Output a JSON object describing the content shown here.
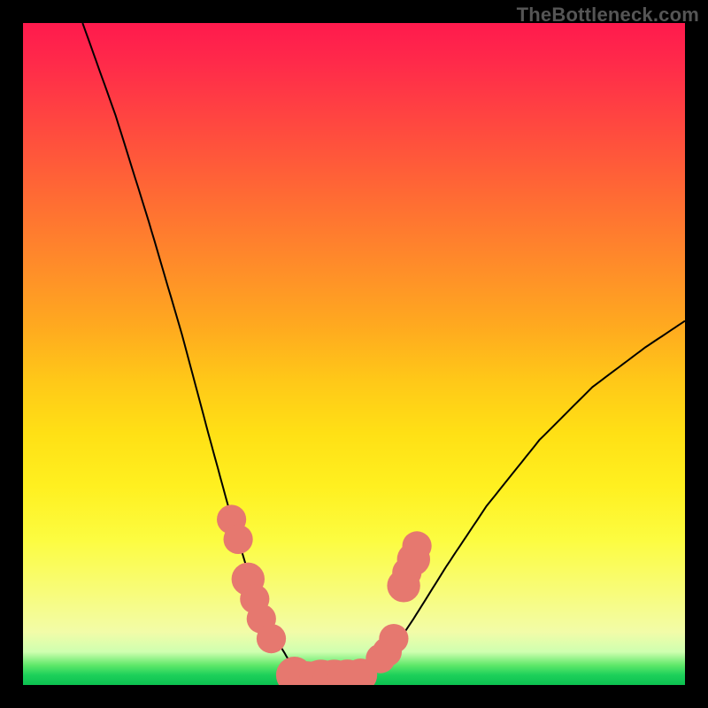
{
  "watermark": "TheBottleneck.com",
  "chart_data": {
    "type": "line",
    "title": "",
    "xlabel": "",
    "ylabel": "",
    "xlim": [
      0,
      100
    ],
    "ylim": [
      0,
      100
    ],
    "curve_left": [
      {
        "x": 9,
        "y": 100
      },
      {
        "x": 14,
        "y": 86
      },
      {
        "x": 19,
        "y": 70
      },
      {
        "x": 24,
        "y": 53
      },
      {
        "x": 28,
        "y": 38
      },
      {
        "x": 31,
        "y": 27
      },
      {
        "x": 34,
        "y": 17
      },
      {
        "x": 37,
        "y": 9
      },
      {
        "x": 40,
        "y": 4
      },
      {
        "x": 43,
        "y": 1
      },
      {
        "x": 45,
        "y": 0
      }
    ],
    "curve_flat": [
      {
        "x": 45,
        "y": 0
      },
      {
        "x": 49,
        "y": 0
      }
    ],
    "curve_right": [
      {
        "x": 49,
        "y": 0
      },
      {
        "x": 52,
        "y": 1
      },
      {
        "x": 55,
        "y": 4
      },
      {
        "x": 59,
        "y": 10
      },
      {
        "x": 64,
        "y": 18
      },
      {
        "x": 70,
        "y": 27
      },
      {
        "x": 78,
        "y": 37
      },
      {
        "x": 86,
        "y": 45
      },
      {
        "x": 94,
        "y": 51
      },
      {
        "x": 100,
        "y": 55
      }
    ],
    "markers_left": [
      {
        "x": 31.5,
        "y": 25,
        "r": 1.2
      },
      {
        "x": 32.5,
        "y": 22,
        "r": 1.2
      },
      {
        "x": 34,
        "y": 16,
        "r": 1.4
      },
      {
        "x": 35,
        "y": 13,
        "r": 1.2
      },
      {
        "x": 36,
        "y": 10,
        "r": 1.2
      },
      {
        "x": 37.5,
        "y": 7,
        "r": 1.2
      }
    ],
    "markers_bottom": [
      {
        "x": 41,
        "y": 1.5,
        "r": 1.6
      },
      {
        "x": 43,
        "y": 0.8,
        "r": 1.6
      },
      {
        "x": 45,
        "y": 0.5,
        "r": 2.0
      },
      {
        "x": 47,
        "y": 0.5,
        "r": 2.0
      },
      {
        "x": 49,
        "y": 0.8,
        "r": 1.8
      },
      {
        "x": 51,
        "y": 1.5,
        "r": 1.4
      }
    ],
    "markers_right": [
      {
        "x": 54,
        "y": 4,
        "r": 1.2
      },
      {
        "x": 55,
        "y": 5,
        "r": 1.2
      },
      {
        "x": 56,
        "y": 7,
        "r": 1.2
      },
      {
        "x": 57.5,
        "y": 15,
        "r": 1.4
      },
      {
        "x": 58,
        "y": 17,
        "r": 1.2
      },
      {
        "x": 59,
        "y": 19,
        "r": 1.4
      },
      {
        "x": 59.5,
        "y": 21,
        "r": 1.2
      }
    ]
  }
}
